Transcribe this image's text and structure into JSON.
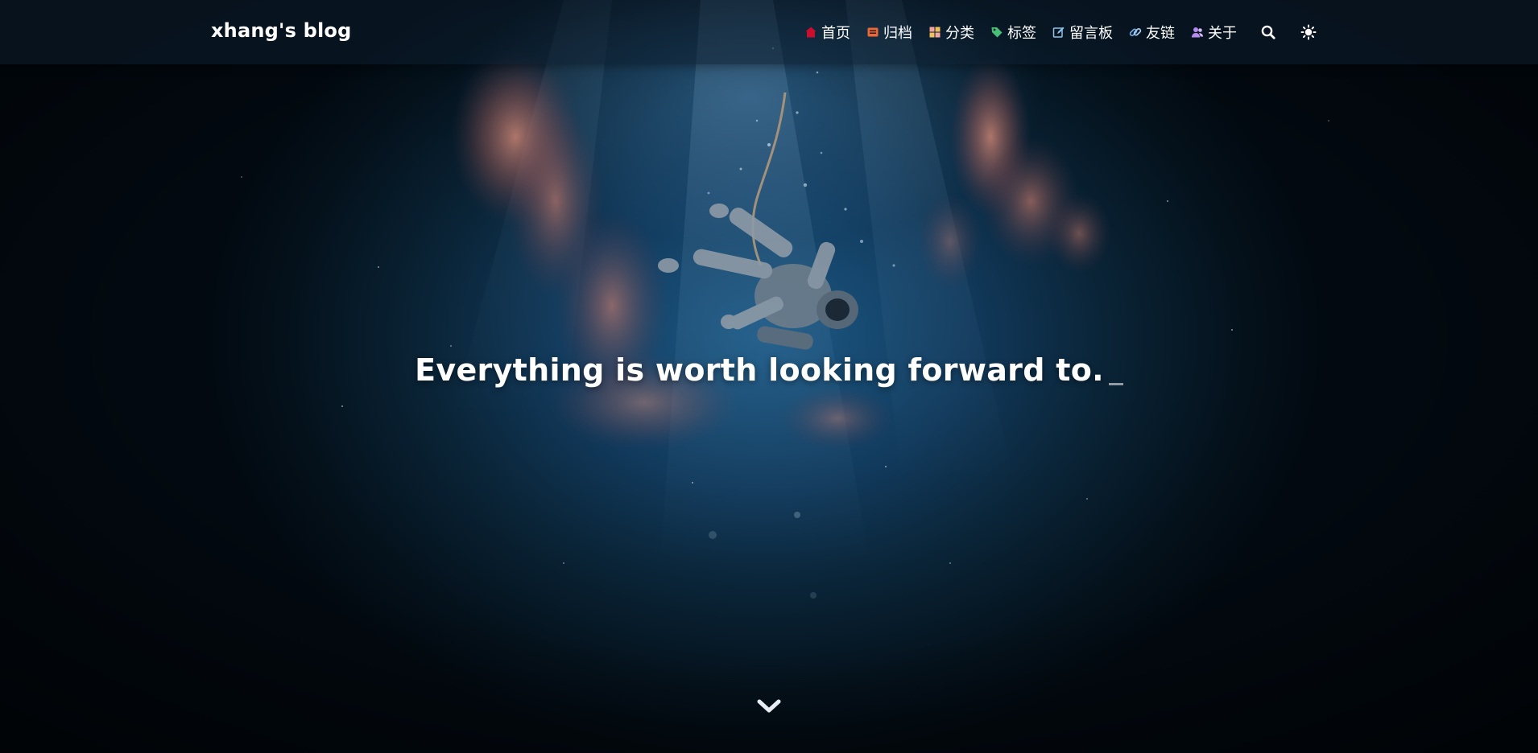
{
  "brand": {
    "title": "xhang's blog"
  },
  "nav": {
    "items": [
      {
        "label": "首页",
        "icon": "home-icon",
        "color": "#c8102e"
      },
      {
        "label": "归档",
        "icon": "archive-icon",
        "color": "#e8683a"
      },
      {
        "label": "分类",
        "icon": "category-icon",
        "color": "#f3a6a0"
      },
      {
        "label": "标签",
        "icon": "tag-icon",
        "color": "#49c07a"
      },
      {
        "label": "留言板",
        "icon": "edit-icon",
        "color": "#8fc3ea"
      },
      {
        "label": "友链",
        "icon": "link-icon",
        "color": "#6ea8e0"
      },
      {
        "label": "关于",
        "icon": "users-icon",
        "color": "#b48cf0"
      }
    ],
    "tools": [
      {
        "icon": "search-icon"
      },
      {
        "icon": "sun-icon"
      }
    ]
  },
  "hero": {
    "slogan": "Everything is worth looking forward to."
  },
  "scroll": {
    "icon": "chevron-down-icon"
  }
}
